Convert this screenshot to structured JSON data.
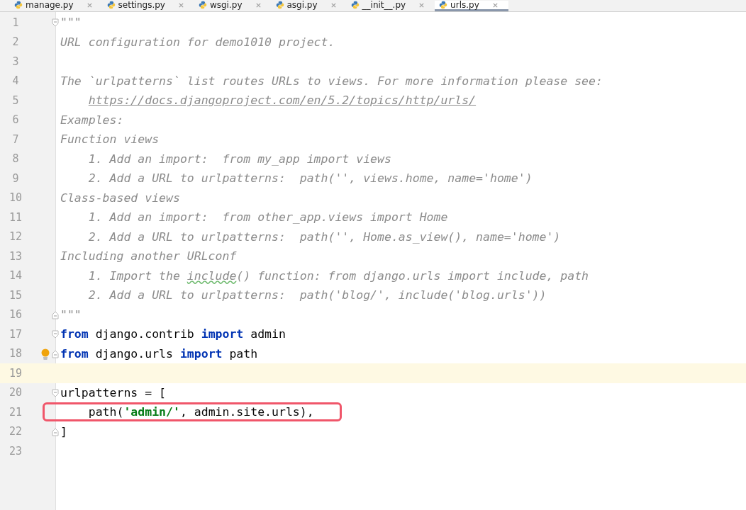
{
  "tabs": [
    {
      "label": "manage.py",
      "selected": false
    },
    {
      "label": "settings.py",
      "selected": false
    },
    {
      "label": "wsgi.py",
      "selected": false
    },
    {
      "label": "asgi.py",
      "selected": false
    },
    {
      "label": "__init__.py",
      "selected": false
    },
    {
      "label": "urls.py",
      "selected": true
    }
  ],
  "editor": {
    "lines": [
      {
        "number": "1",
        "fold_start": true,
        "tokens": [
          {
            "text": "\"\"\"",
            "kind": "comment"
          }
        ]
      },
      {
        "number": "2",
        "tokens": [
          {
            "text": "URL configuration for demo1010 project.",
            "kind": "comment"
          }
        ]
      },
      {
        "number": "3"
      },
      {
        "number": "4",
        "tokens": [
          {
            "text": "The `urlpatterns` list routes URLs to views. For more information please see:",
            "kind": "comment"
          }
        ]
      },
      {
        "number": "5",
        "indented": true,
        "tokens": [
          {
            "text": "https://docs.djangoproject.com/en/5.2/topics/http/urls/",
            "kind": "link"
          }
        ]
      },
      {
        "number": "6",
        "tokens": [
          {
            "text": "Examples:",
            "kind": "comment"
          }
        ]
      },
      {
        "number": "7",
        "tokens": [
          {
            "text": "Function views",
            "kind": "comment"
          }
        ]
      },
      {
        "number": "8",
        "tokens": [
          {
            "text": "    1. Add an import:  from my_app import views",
            "kind": "comment"
          }
        ]
      },
      {
        "number": "9",
        "tokens": [
          {
            "text": "    2. Add a URL to urlpatterns:  path('', views.home, name='home')",
            "kind": "comment"
          }
        ]
      },
      {
        "number": "10",
        "tokens": [
          {
            "text": "Class-based views",
            "kind": "comment"
          }
        ]
      },
      {
        "number": "11",
        "tokens": [
          {
            "text": "    1. Add an import:  from other_app.views import Home",
            "kind": "comment"
          }
        ]
      },
      {
        "number": "12",
        "tokens": [
          {
            "text": "    2. Add a URL to urlpatterns:  path('', Home.as_view(), name='home')",
            "kind": "comment"
          }
        ]
      },
      {
        "number": "13",
        "tokens": [
          {
            "text": "Including another URLconf",
            "kind": "comment"
          }
        ]
      },
      {
        "number": "14",
        "tokens": [
          {
            "text": "    1. Import the ",
            "kind": "comment"
          },
          {
            "text": "include",
            "kind": "typo"
          },
          {
            "text": "() function: from django.urls import include, path",
            "kind": "comment"
          }
        ]
      },
      {
        "number": "15",
        "tokens": [
          {
            "text": "    2. Add a URL to urlpatterns:  path('blog/', include('blog.urls'))",
            "kind": "comment"
          }
        ]
      },
      {
        "number": "16",
        "fold_end": true,
        "tokens": [
          {
            "text": "\"\"\"",
            "kind": "comment"
          }
        ]
      },
      {
        "number": "17",
        "fold_start": true,
        "tokens": [
          {
            "text": "from",
            "kind": "keyword"
          },
          {
            "text": " django.contrib ",
            "kind": "plain"
          },
          {
            "text": "import",
            "kind": "keyword"
          },
          {
            "text": " admin",
            "kind": "plain"
          }
        ]
      },
      {
        "number": "18",
        "fold_end": true,
        "bulb": true,
        "tokens": [
          {
            "text": "from",
            "kind": "keyword"
          },
          {
            "text": " django.urls ",
            "kind": "plain"
          },
          {
            "text": "import",
            "kind": "keyword"
          },
          {
            "text": " path",
            "kind": "plain"
          }
        ]
      },
      {
        "number": "19",
        "current": true
      },
      {
        "number": "20",
        "fold_start": true,
        "tokens": [
          {
            "text": "urlpatterns = [",
            "kind": "plain"
          }
        ]
      },
      {
        "number": "21",
        "boxed": true,
        "tokens": [
          {
            "text": "    path(",
            "kind": "plain"
          },
          {
            "text": "'admin/'",
            "kind": "string"
          },
          {
            "text": ", admin.site.urls),",
            "kind": "plain"
          }
        ]
      },
      {
        "number": "22",
        "fold_end": true,
        "tokens": [
          {
            "text": "]",
            "kind": "plain"
          }
        ]
      },
      {
        "number": "23"
      }
    ]
  }
}
